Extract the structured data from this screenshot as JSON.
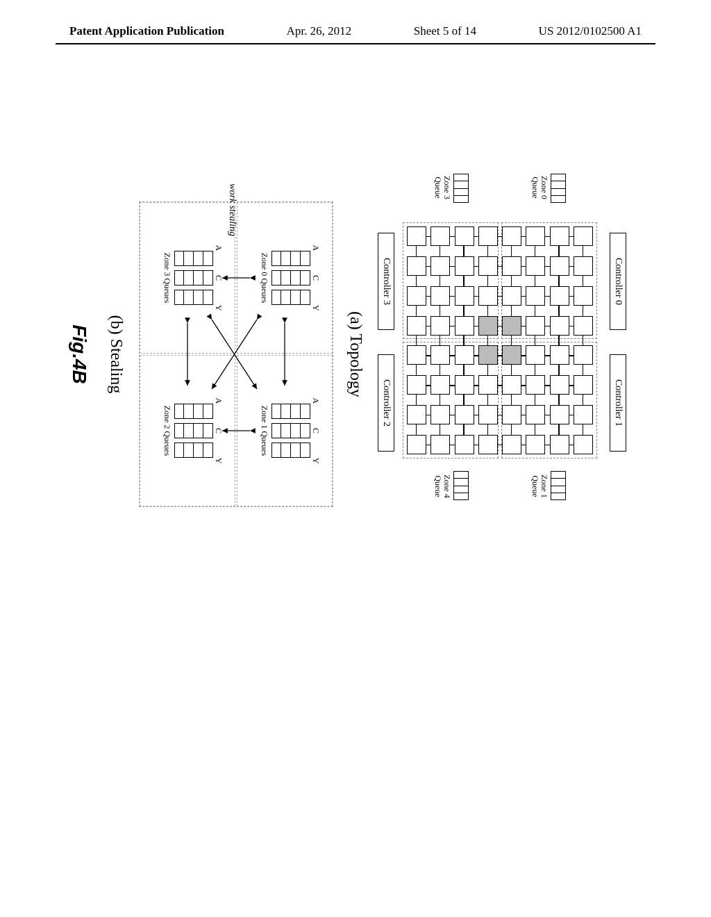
{
  "header": {
    "left": "Patent Application Publication",
    "date": "Apr. 26, 2012",
    "sheet": "Sheet 5 of 14",
    "pubno": "US 2012/0102500 A1"
  },
  "topology": {
    "controllers": [
      "Controller 0",
      "Controller 1",
      "Controller 2",
      "Controller 3"
    ],
    "grid_rows": 8,
    "grid_cols": 8,
    "shaded_tiles": [
      [
        3,
        3
      ],
      [
        3,
        4
      ],
      [
        4,
        3
      ],
      [
        4,
        4
      ]
    ],
    "zones": [
      {
        "name": "Zone 0",
        "queue_label": "Zone 0\nQueue"
      },
      {
        "name": "Zone 1",
        "queue_label": "Zone 1\nQueue"
      },
      {
        "name": "Zone 3",
        "queue_label": "Zone 3\nQueue"
      },
      {
        "name": "Zone 4",
        "queue_label": "Zone 4\nQueue"
      }
    ],
    "caption": "(a) Topology"
  },
  "stealing": {
    "queue_headers": [
      "A",
      "C",
      "Y"
    ],
    "zones": [
      {
        "label": "Zone 0\nQueues"
      },
      {
        "label": "Zone 1\nQueues"
      },
      {
        "label": "Zone 3\nQueues"
      },
      {
        "label": "Zone 2\nQueues"
      }
    ],
    "work_stealing_label": "work\nstealing",
    "caption": "(b) Stealing"
  },
  "figure_label": "Fig.4B"
}
